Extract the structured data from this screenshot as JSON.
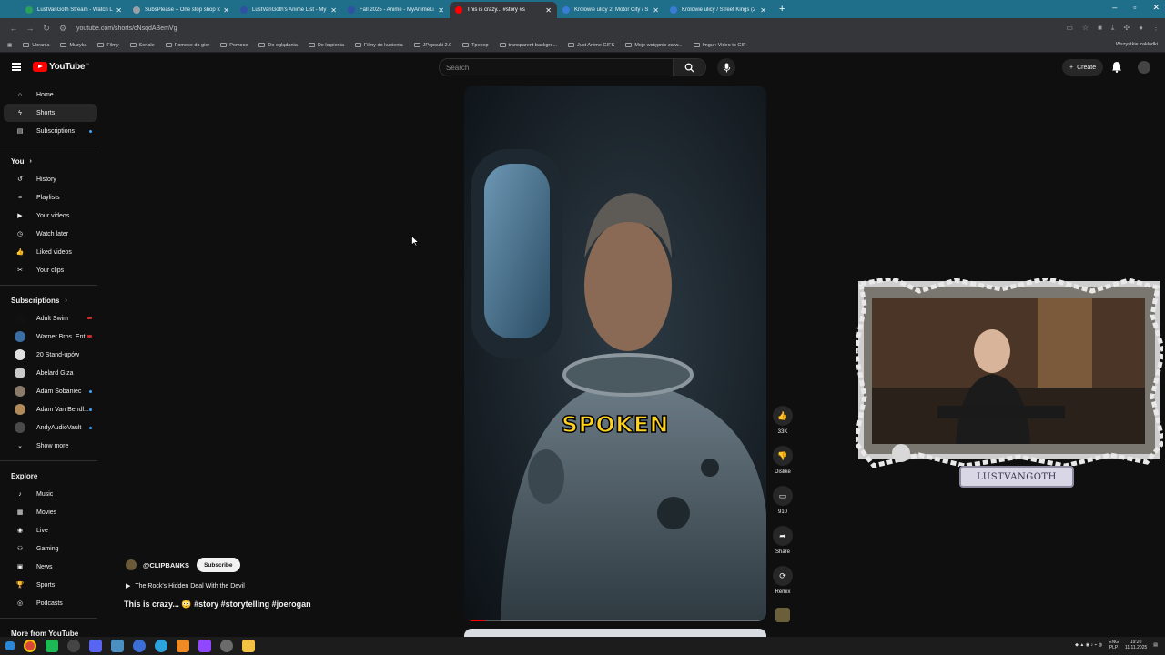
{
  "browser": {
    "tabs": [
      {
        "label": "LustVanGoth Stream - Watch L",
        "color": "#2aa05a",
        "active": false
      },
      {
        "label": "SubsPlease – One stop shop fo",
        "color": "#9aa0a6",
        "active": false
      },
      {
        "label": "LustVanGoth's Anime List - My",
        "color": "#2e51a2",
        "active": false
      },
      {
        "label": "Fall 2025 - Anime - MyAnimeLi",
        "color": "#2e51a2",
        "active": false
      },
      {
        "label": "This is crazy... #story #s",
        "color": "#ff0000",
        "active": true
      },
      {
        "label": "Królowie ulicy 2: Motor City / S",
        "color": "#3a7bd5",
        "active": false
      },
      {
        "label": "Królowie ulicy / Street Kings (2",
        "color": "#3a7bd5",
        "active": false
      }
    ],
    "new_tab": "+",
    "url": "youtube.com/shorts/cNsqdABemVg",
    "bookmarks": [
      "Ubrania",
      "Muzyka",
      "Filmy",
      "Seriale",
      "Pomoce do gier",
      "Pomoce",
      "Do oglądania",
      "Do kupienia",
      "Filmy do kupienia",
      "JPopsuki 2.0",
      "Tpexep",
      "transparent backgro...",
      "Just Anime GIFS",
      "Moje wstępnie zatw...",
      "Imgur: Video to GIF"
    ],
    "bookmarks_right": "Wszystkie zakładki"
  },
  "header": {
    "logo": "YouTube",
    "logo_cc": "PL",
    "search_placeholder": "Search",
    "create_label": "Create"
  },
  "sidebar": {
    "main": [
      {
        "label": "Home",
        "icon": "home-icon"
      },
      {
        "label": "Shorts",
        "icon": "shorts-icon",
        "active": true
      },
      {
        "label": "Subscriptions",
        "icon": "subscriptions-icon",
        "dot": true
      }
    ],
    "you_title": "You",
    "you": [
      {
        "label": "History",
        "icon": "history-icon"
      },
      {
        "label": "Playlists",
        "icon": "playlists-icon"
      },
      {
        "label": "Your videos",
        "icon": "your-videos-icon"
      },
      {
        "label": "Watch later",
        "icon": "watch-later-icon"
      },
      {
        "label": "Liked videos",
        "icon": "liked-videos-icon"
      },
      {
        "label": "Your clips",
        "icon": "clips-icon"
      }
    ],
    "subs_title": "Subscriptions",
    "subs": [
      {
        "label": "Adult Swim",
        "color": "#111111",
        "live": true
      },
      {
        "label": "Warner Bros. Ent...",
        "color": "#3a6ea5",
        "live": true
      },
      {
        "label": "20 Stand-upów",
        "color": "#e0e0e0",
        "dot": false
      },
      {
        "label": "Abelard Giza",
        "color": "#c9c9c9",
        "dot": false
      },
      {
        "label": "Adam Sobaniec",
        "color": "#8a7a6a",
        "dot": true
      },
      {
        "label": "Adam Van Bendl...",
        "color": "#b08a5a",
        "dot": true
      },
      {
        "label": "AndyAudioVault",
        "color": "#4a4a4a",
        "dot": true
      }
    ],
    "show_more": "Show more",
    "explore_title": "Explore",
    "explore": [
      {
        "label": "Music",
        "icon": "music-icon"
      },
      {
        "label": "Movies",
        "icon": "movies-icon"
      },
      {
        "label": "Live",
        "icon": "live-icon"
      },
      {
        "label": "Gaming",
        "icon": "gaming-icon"
      },
      {
        "label": "News",
        "icon": "news-icon"
      },
      {
        "label": "Sports",
        "icon": "sports-icon"
      },
      {
        "label": "Podcasts",
        "icon": "podcasts-icon"
      }
    ],
    "more_title": "More from YouTube"
  },
  "short": {
    "caption": "SPOKEN",
    "progress": 0.07,
    "channel": "@CLIPBANKS",
    "subscribe": "Subscribe",
    "related": "The Rock's Hidden Deal With the Devil",
    "title": "This is crazy... 😳 #story #storytelling #joerogan"
  },
  "actions": [
    {
      "label": "33K",
      "icon": "like-icon"
    },
    {
      "label": "Dislike",
      "icon": "dislike-icon"
    },
    {
      "label": "910",
      "icon": "comments-icon"
    },
    {
      "label": "Share",
      "icon": "share-icon"
    },
    {
      "label": "Remix",
      "icon": "remix-icon"
    }
  ],
  "webcam": {
    "nameplate": "LUSTVANGOTH"
  },
  "taskbar": {
    "lang": "ENG",
    "lang2": "PLP",
    "time": "19:20",
    "date": "11.11.2025"
  }
}
